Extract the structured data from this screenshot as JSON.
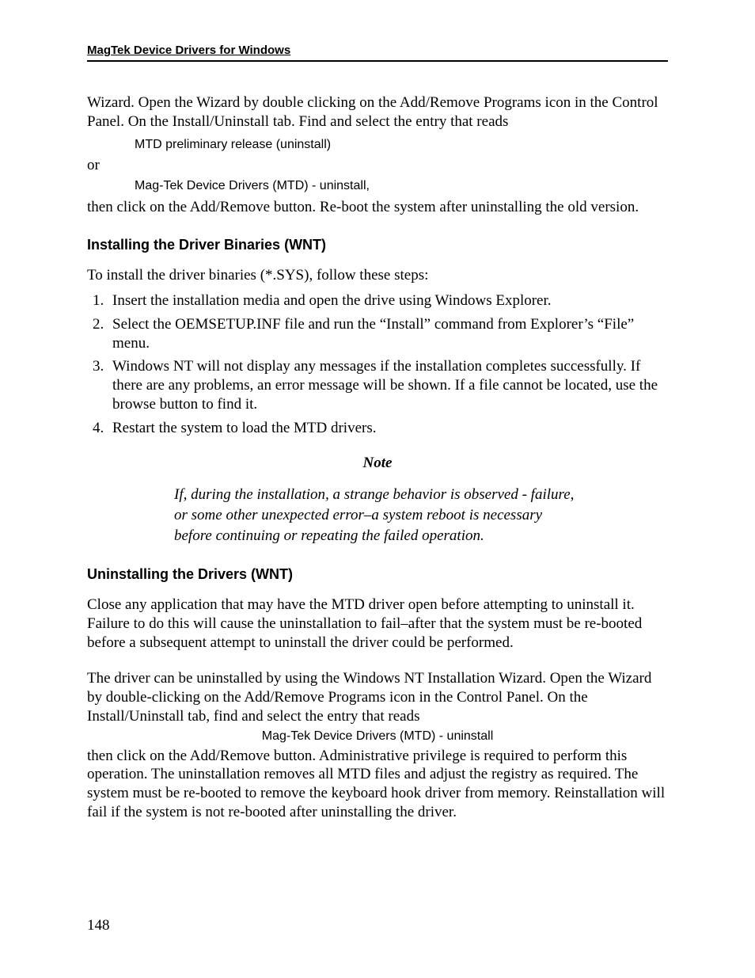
{
  "header": {
    "running_title": "MagTek Device Drivers for Windows"
  },
  "intro": {
    "p1": "Wizard.  Open the Wizard by double clicking on the Add/Remove Programs icon in the Control Panel. On the Install/Uninstall tab.  Find and select the entry that reads",
    "code1": "MTD preliminary release (uninstall)",
    "or": "or",
    "code2": "Mag-Tek Device Drivers (MTD) - uninstall,",
    "p2": "then click on the Add/Remove button.  Re-boot the system after uninstalling the old version."
  },
  "install": {
    "heading": "Installing the Driver Binaries (WNT)",
    "p1": "To install the driver binaries (*.SYS), follow these steps:",
    "steps": [
      "Insert the installation media and open the drive using Windows Explorer.",
      "Select the OEMSETUP.INF file and run the “Install” command from Explorer’s “File” menu.",
      "Windows NT will not display any messages if the installation completes successfully.  If there are any problems, an error message will be shown.  If a file cannot be located, use the browse button to find it.",
      "Restart the system to load the MTD drivers."
    ]
  },
  "note": {
    "title": "Note",
    "body": "If, during the installation, a strange behavior is observed - failure, or some other unexpected error–a system reboot is necessary before continuing or repeating the failed operation."
  },
  "uninstall": {
    "heading": "Uninstalling the Drivers (WNT)",
    "p1": "Close any application that may have the MTD driver open before attempting to uninstall it.  Failure to do this will cause the uninstallation to fail–after that the system must be re-booted before a subsequent attempt to uninstall the driver could be performed.",
    "p2": "The driver can be uninstalled by using the Windows NT Installation Wizard.  Open the Wizard by double-clicking on the Add/Remove Programs icon in the Control Panel. On the Install/Uninstall tab, find and select the entry that reads",
    "code": "Mag-Tek Device Drivers (MTD) - uninstall",
    "p3": "then click on the Add/Remove button.  Administrative privilege is required to perform this operation.  The uninstallation removes all MTD files and adjust the registry as required.  The system must be re-booted to remove the keyboard hook driver from memory.  Reinstallation will fail if the system is not re-booted after uninstalling the driver."
  },
  "page_number": "148"
}
